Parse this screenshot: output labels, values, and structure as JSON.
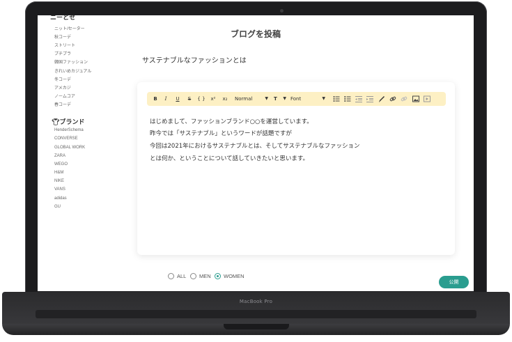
{
  "device": {
    "label": "MacBook Pro"
  },
  "sidebar": {
    "category_heading": "ニーとセ",
    "categories": [
      "ニット/セーター",
      "秋コーデ",
      "ストリート",
      "プチプラ",
      "韓国ファッション",
      "きれいめカジュアル",
      "冬コーデ",
      "アメカジ",
      "ノームコア",
      "春コーデ"
    ],
    "brand_heading": "ブランド",
    "brand_icon": "tshirt-icon",
    "brands": [
      "HenderSchema",
      "CONVERSE",
      "GLOBAL WORK",
      "ZARA",
      "WEGO",
      "H&M",
      "NIKE",
      "VANS",
      "adidas",
      "GU"
    ]
  },
  "page": {
    "title": "ブログを投稿",
    "post_title": "サステナブルなファッションとは"
  },
  "toolbar": {
    "bold": "B",
    "italic": "I",
    "underline": "U",
    "strike": "S",
    "code": "{ }",
    "superscript": "x²",
    "subscript": "x₂",
    "heading_select": "Normal",
    "text_size": "T",
    "font_select": "Font",
    "icons": [
      "bullet-list-icon",
      "ordered-list-icon",
      "outdent-icon",
      "indent-icon",
      "pen-icon",
      "link-icon",
      "unlink-icon",
      "image-icon",
      "video-icon"
    ]
  },
  "editor": {
    "lines": [
      "はじめまして、ファッションブランド○○を運営しています。",
      "昨今では「サステナブル」というワードが話題ですが",
      "今回は2021年におけるサステナブルとは、そしてサステナブルなファッション",
      "とは何か、ということについて話していきたいと思います。"
    ]
  },
  "audience": {
    "options": [
      "ALL",
      "MEN",
      "WOMEN"
    ],
    "selected": "WOMEN"
  },
  "actions": {
    "publish": "公開"
  },
  "colors": {
    "accent": "#2a9d8f",
    "toolbar_bg": "#fdf0c4"
  }
}
